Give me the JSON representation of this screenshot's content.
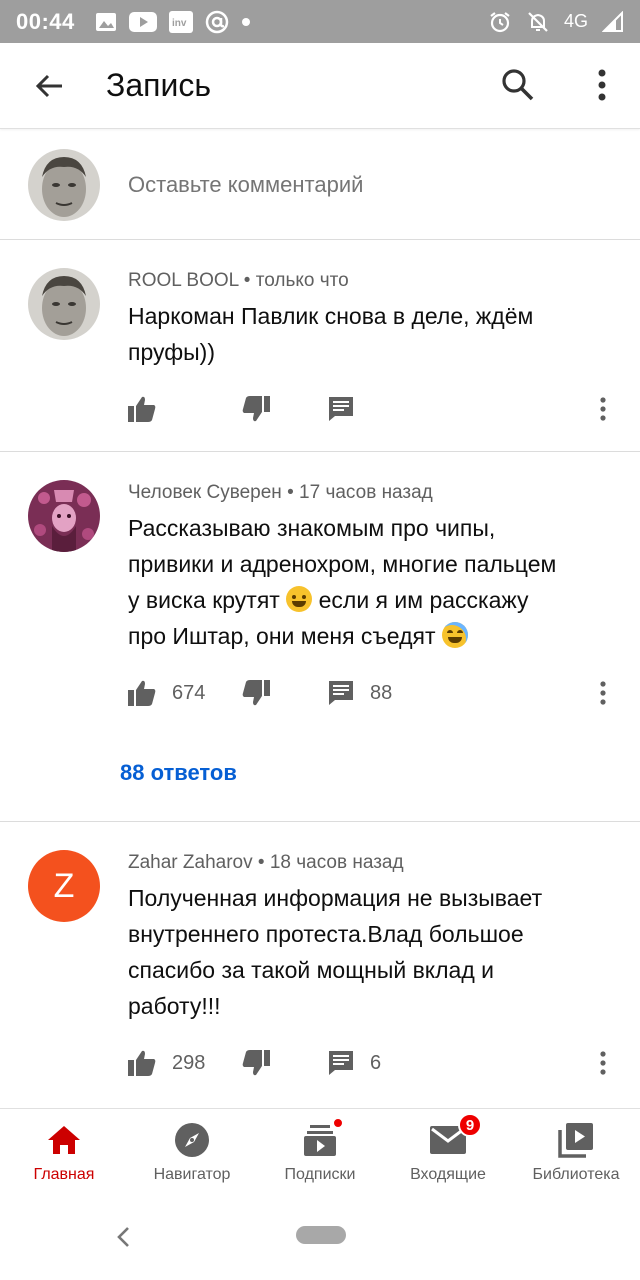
{
  "status_bar": {
    "time": "00:44",
    "network": "4G",
    "left_icons": [
      "gallery-icon",
      "youtube-icon",
      "invideo-icon",
      "at-icon",
      "dot-icon"
    ],
    "right_icons": [
      "alarm-icon",
      "bell-off-icon",
      "signal-icon"
    ]
  },
  "app_bar": {
    "title": "Запись",
    "icons": [
      "back-arrow-icon",
      "search-icon",
      "more-vert-icon"
    ]
  },
  "add_comment": {
    "placeholder": "Оставьте комментарий"
  },
  "comments": [
    {
      "author": "ROOL BOOL",
      "time": "только что",
      "text_lines": [
        "Наркоман Павлик снова в деле, ждём",
        "пруфы))"
      ],
      "likes": "",
      "replies_count": "",
      "avatar_color": "#d9d9d9"
    },
    {
      "author": "Человек Суверен",
      "time": "17 часов назад",
      "text_lines": [
        "Рассказываю знакомым про чипы,",
        "привики и адренохром, многие пальцем",
        "у виска крутят",
        "если я им расскажу",
        "про Иштар, они меня съедят"
      ],
      "likes": "674",
      "replies_count": "88",
      "replies_link": "88 ответов",
      "avatar_color": "#9c3f6b"
    },
    {
      "author": "Zahar Zaharov",
      "time": "18 часов назад",
      "text_lines": [
        "Полученная информация не вызывает",
        "внутреннего протеста.Влад большое",
        "спасибо за такой мощный вклад и",
        "работу!!!"
      ],
      "likes": "298",
      "replies_count": "6",
      "avatar_letter": "Z",
      "avatar_color": "#f4511e"
    }
  ],
  "meta_separator": "•",
  "bottom_nav": {
    "items": [
      {
        "label": "Главная",
        "icon": "home-icon",
        "active": true
      },
      {
        "label": "Навигатор",
        "icon": "compass-icon",
        "active": false
      },
      {
        "label": "Подписки",
        "icon": "subscriptions-icon",
        "active": false
      },
      {
        "label": "Входящие",
        "icon": "inbox-icon",
        "active": false,
        "badge": "9"
      },
      {
        "label": "Библиотека",
        "icon": "library-icon",
        "active": false
      }
    ]
  },
  "colors": {
    "accent_red": "#cc0000",
    "link_blue": "#065fd4",
    "status_bar_bg": "#9e9e9e",
    "badge_red": "#ee0000"
  }
}
